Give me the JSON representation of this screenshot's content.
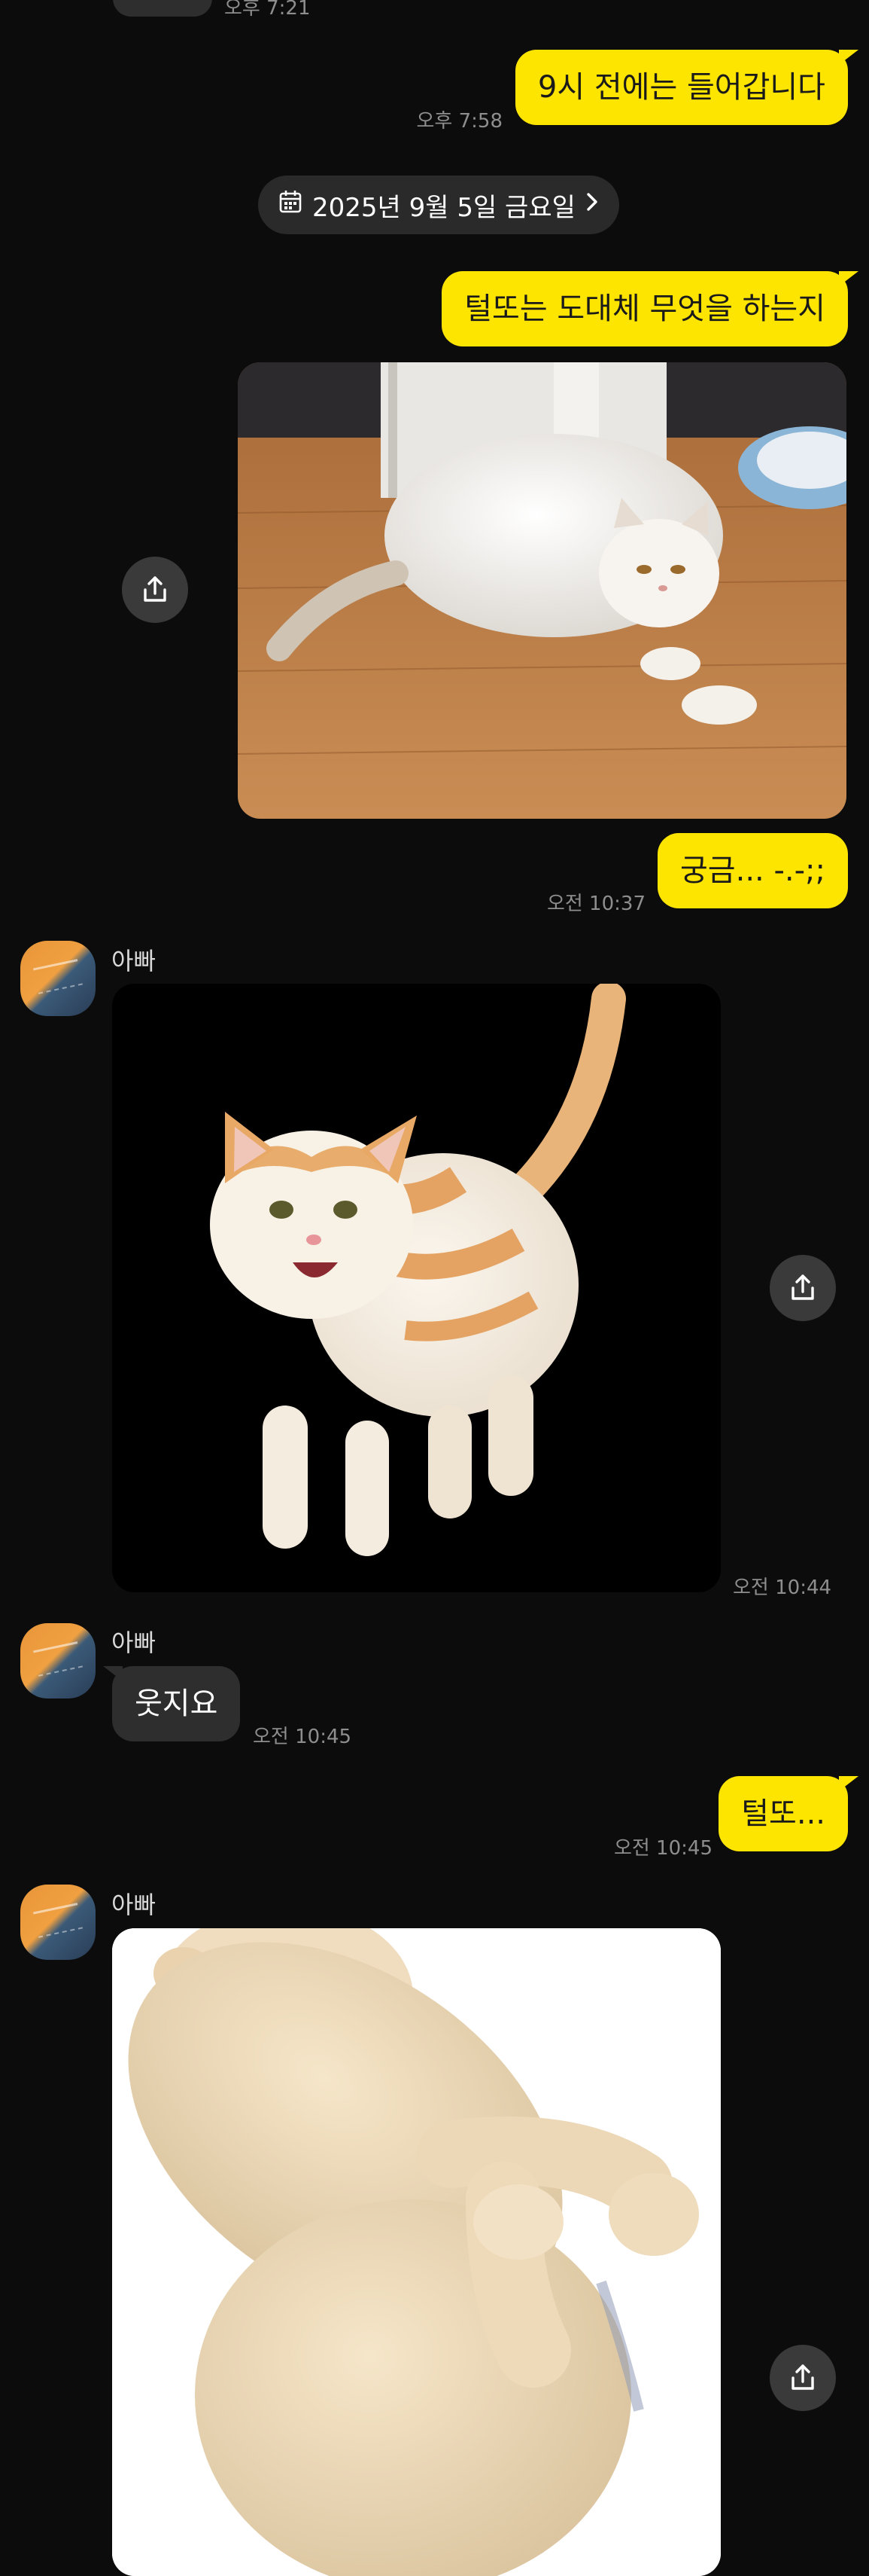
{
  "top": {
    "partial_time": "오후 7:21"
  },
  "messages": {
    "m1": {
      "text": "9시 전에는 들어갑니다",
      "time": "오후 7:58"
    },
    "date_divider": {
      "label": "2025년 9월 5일 금요일"
    },
    "m2": {
      "text": "털또는 도대체 무엇을 하는지"
    },
    "m3": {
      "text": "궁금... -.-;;",
      "time": "오전 10:37"
    },
    "m4": {
      "sender": "아빠",
      "time": "오전 10:44"
    },
    "m5": {
      "sender": "아빠",
      "text": "웃지요",
      "time": "오전 10:45"
    },
    "m6": {
      "text": "털또...",
      "time": "오전 10:45"
    },
    "m7": {
      "sender": "아빠"
    }
  },
  "icons": {
    "share": "share-upload-icon",
    "calendar": "calendar-icon",
    "chevron": "chevron-right-icon"
  },
  "colors": {
    "background": "#0c0c0c",
    "outgoing_bubble": "#fee500",
    "incoming_bubble": "#2e2e2e",
    "timestamp": "#8e8e8e"
  }
}
